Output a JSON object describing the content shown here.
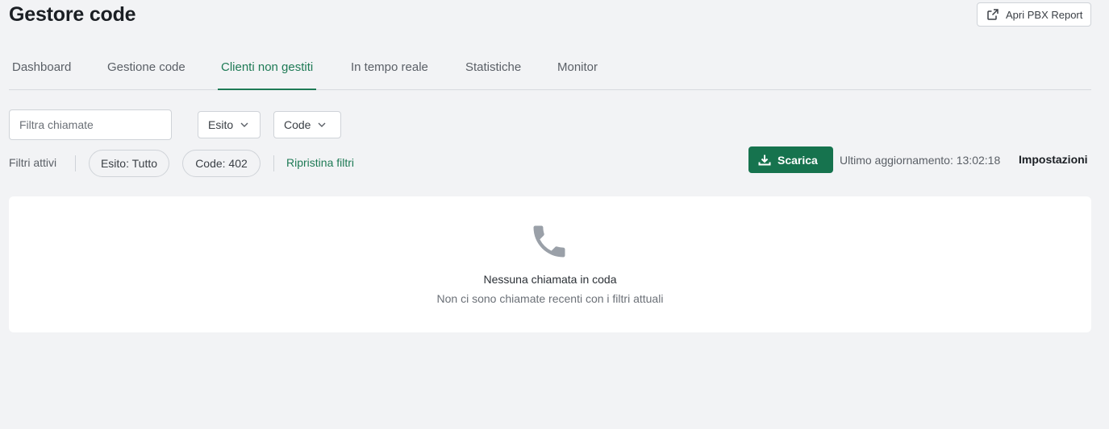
{
  "header": {
    "title": "Gestore code",
    "pbx_button_label": "Apri PBX Report"
  },
  "tabs": [
    {
      "label": "Dashboard",
      "active": false
    },
    {
      "label": "Gestione code",
      "active": false
    },
    {
      "label": "Clienti non gestiti",
      "active": true
    },
    {
      "label": "In tempo reale",
      "active": false
    },
    {
      "label": "Statistiche",
      "active": false
    },
    {
      "label": "Monitor",
      "active": false
    }
  ],
  "filters": {
    "search_placeholder": "Filtra chiamate",
    "search_value": "",
    "esito_label": "Esito",
    "code_label": "Code",
    "active_label": "Filtri attivi",
    "chips": [
      "Esito: Tutto",
      "Code: 402"
    ],
    "reset_label": "Ripristina filtri"
  },
  "toolbar": {
    "download_label": "Scarica",
    "last_update": "Ultimo aggiornamento: 13:02:18",
    "settings_label": "Impostazioni"
  },
  "empty_state": {
    "icon": "phone-icon",
    "title": "Nessuna chiamata in coda",
    "subtitle": "Non ci sono chiamate recenti con i filtri attuali"
  },
  "colors": {
    "accent": "#1e7a55",
    "button_green": "#16734e",
    "background": "#f2f3f5",
    "icon_gray": "#9aa0a8"
  }
}
